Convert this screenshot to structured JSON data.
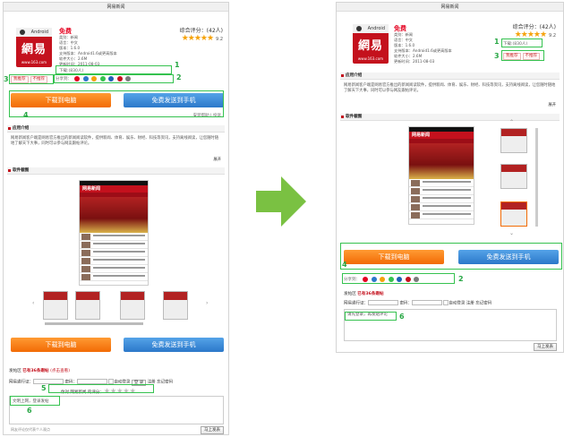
{
  "colors": {
    "highlight": "#35c24f",
    "brand_red": "#c4111d",
    "download_orange": "#f26b05",
    "send_blue": "#2b78c9",
    "star": "#f5a20a",
    "arrow": "#7ac142"
  },
  "icons": {
    "arrow": "arrow-right-icon",
    "android": "android-icon",
    "star": "star-icon"
  },
  "topbar": {
    "title": "网易新闻"
  },
  "app": {
    "brand": "網易",
    "android_label": "Android",
    "domain": "www.163.com",
    "price": "免费",
    "info": [
      "类别：新闻",
      "语言：中文",
      "版本：1.6.0",
      "支持版本：Android1.6或更高版本",
      "软件大小：2.6M",
      "更新时间：2011-08-03"
    ],
    "rating_label": "综合评分：(42人)",
    "stars": "★★★★★",
    "score": "9.2",
    "download_count_label": "下载:(830人)",
    "tag_recommend": "我推荐",
    "tag_dislike": "不推荐",
    "share_label": "分享到："
  },
  "buttons": {
    "download_pc": "下载到电脑",
    "send_phone": "免费发送到手机"
  },
  "help": {
    "text": "安装帮助 | 投诉"
  },
  "sections": {
    "intro": "应用介绍",
    "screenshots": "软件截图"
  },
  "intro_text": "网易新闻客户端是网易官方推出的新闻阅读软件，提供新闻、体育、娱乐、财经、科技等资讯，支持离线阅读，让您随时随地了解天下大事，同时可以参与网友跟帖评论。",
  "more": "展开",
  "post": {
    "head_prefix": "发帖区",
    "head_count": "已有36条跟帖",
    "head_link": "(点击查看)",
    "user_label": "网易通行证：",
    "pwd_label": "密码：",
    "auto_login": "自动登录",
    "login": "登 录",
    "register": "注册",
    "forgot": "忘记密码",
    "rate_label": "你对 网易新闻 的评分：",
    "placeholder": "文明上网，登录发帖",
    "placeholder_right": "请先登录，再发贴评论",
    "send": "马上发表",
    "footer": "网友评论仅代表个人观点"
  },
  "annotations": [
    "1",
    "2",
    "3",
    "4",
    "5",
    "6"
  ]
}
